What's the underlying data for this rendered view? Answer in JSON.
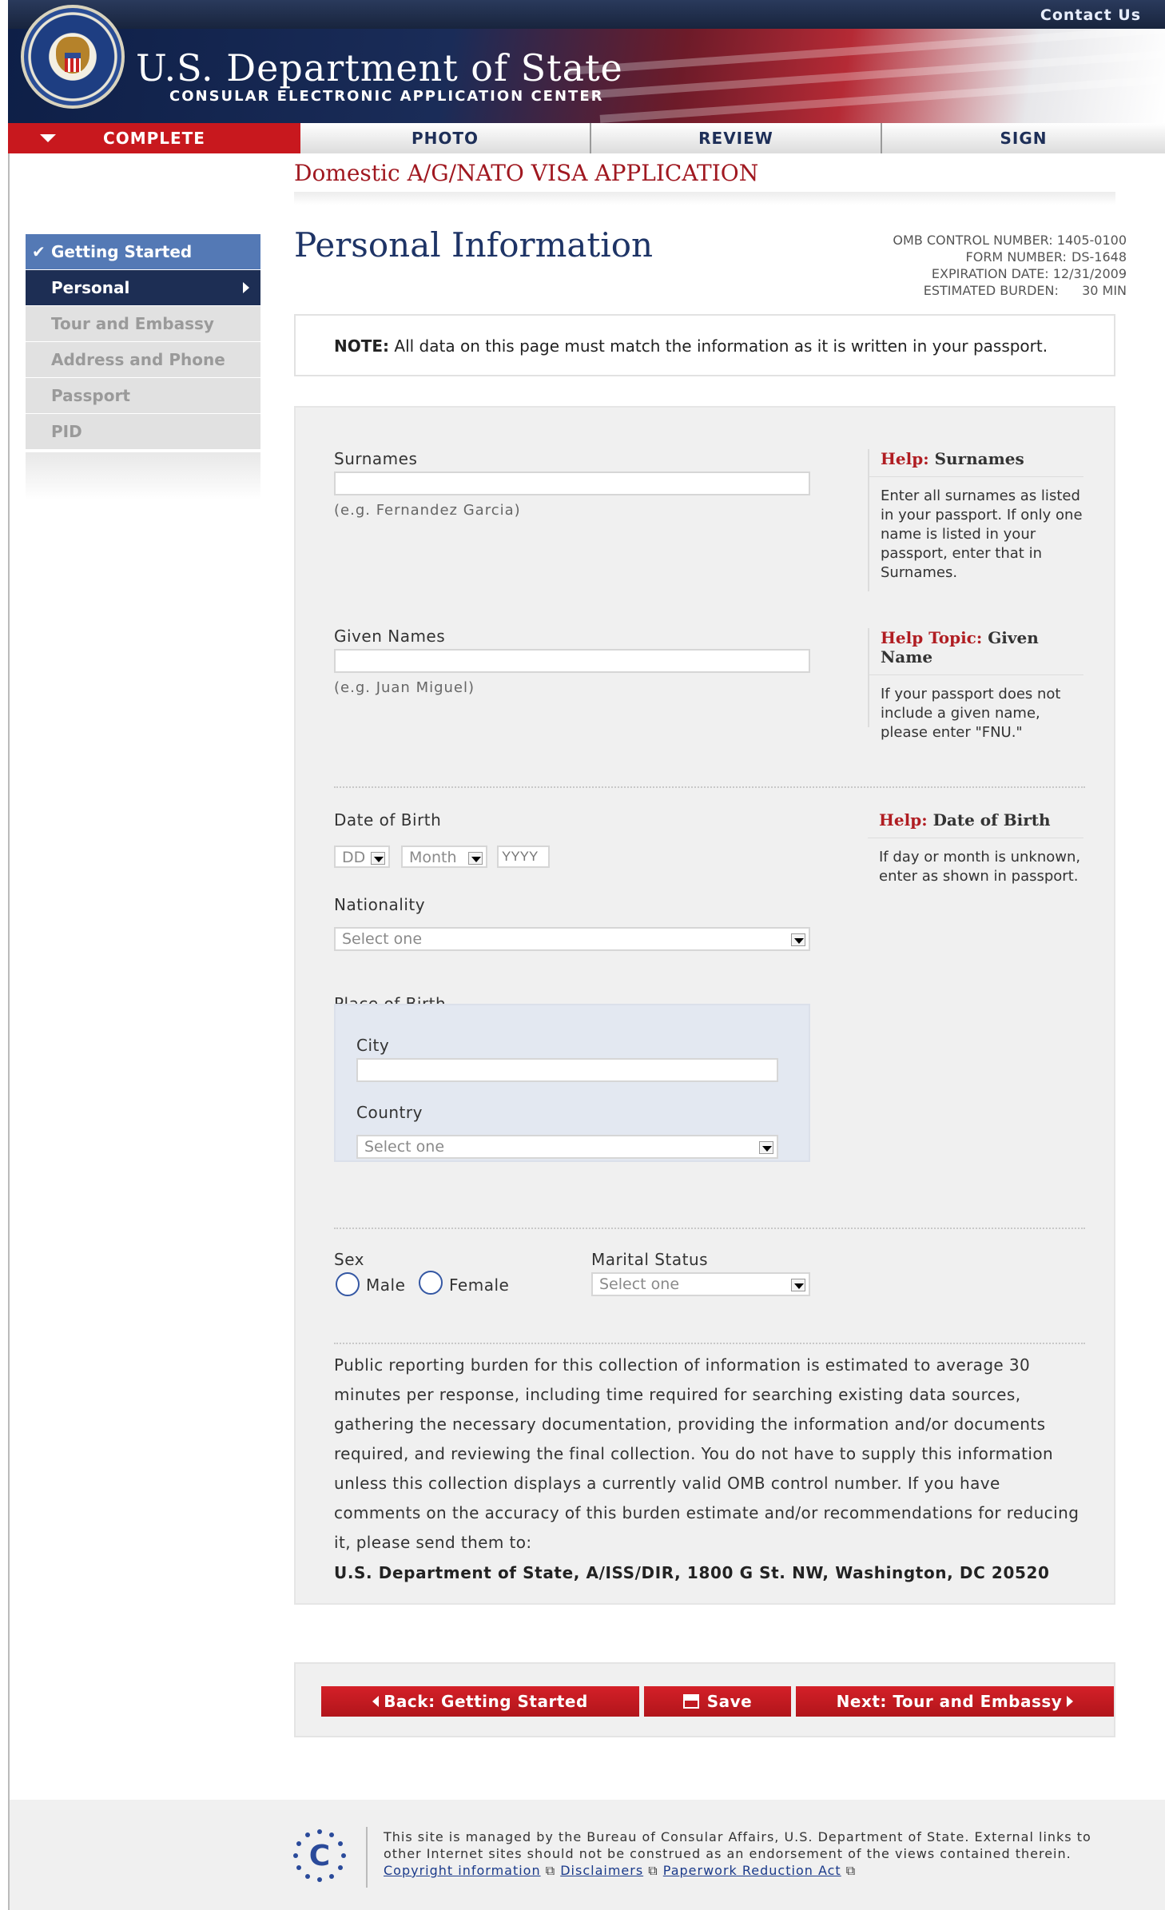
{
  "header": {
    "contact_link": "Contact Us",
    "dept_title": "U.S. Department of State",
    "dept_subtitle": "CONSULAR ELECTRONIC APPLICATION CENTER"
  },
  "nav": {
    "tabs": [
      {
        "label": "COMPLETE"
      },
      {
        "label": "PHOTO"
      },
      {
        "label": "REVIEW"
      },
      {
        "label": "SIGN"
      }
    ]
  },
  "sidebar": {
    "items": [
      {
        "label": "Getting Started",
        "state": "done"
      },
      {
        "label": "Personal",
        "state": "active"
      },
      {
        "label": "Tour and Embassy",
        "state": "disabled"
      },
      {
        "label": "Address and Phone",
        "state": "disabled"
      },
      {
        "label": "Passport",
        "state": "disabled"
      },
      {
        "label": "PID",
        "state": "disabled"
      }
    ]
  },
  "page": {
    "app_title": "Domestic A/G/NATO VISA APPLICATION",
    "title": "Personal Information",
    "omb": {
      "control_number_label": "OMB CONTROL NUMBER:",
      "control_number": "1405-0100",
      "form_number_label": "FORM NUMBER:",
      "form_number": "DS-1648",
      "expiration_label": "EXPIRATION DATE:",
      "expiration": "12/31/2009",
      "burden_label": "ESTIMATED BURDEN:",
      "burden": "30 MIN"
    },
    "note_label": "NOTE:",
    "note_text": " All data on this page must match the information as it is written in your passport."
  },
  "form": {
    "surnames": {
      "label": "Surnames",
      "value": "",
      "hint": "(e.g. Fernandez Garcia)"
    },
    "given_names": {
      "label": "Given Names",
      "value": "",
      "hint": "(e.g. Juan Miguel)"
    },
    "dob": {
      "label": "Date of Birth",
      "day": "DD",
      "month": "Month",
      "year_placeholder": "YYYY"
    },
    "nationality": {
      "label": "Nationality",
      "value": "Select one"
    },
    "place_of_birth": {
      "label": "Place of Birth",
      "city_label": "City",
      "city_value": "",
      "country_label": "Country",
      "country_value": "Select one"
    },
    "sex": {
      "label": "Sex",
      "male": "Male",
      "female": "Female"
    },
    "marital_status": {
      "label": "Marital Status",
      "value": "Select one"
    }
  },
  "help": {
    "surnames": {
      "prefix": "Help:",
      "title": "Surnames",
      "body": "Enter all surnames as listed in your passport. If only one name is listed in your passport, enter that in Surnames."
    },
    "given": {
      "prefix": "Help Topic:",
      "title": "Given Name",
      "body": "If your passport does not include a given name, please enter \"FNU.\""
    },
    "dob": {
      "prefix": "Help:",
      "title": "Date of Birth",
      "body": "If day or month is unknown, enter as shown in passport."
    }
  },
  "burden_statement": {
    "text": "Public reporting burden for this collection of information is estimated to average 30 minutes per response, including time required for searching existing data sources, gathering the necessary documentation, providing the information and/or documents required, and reviewing the final collection.  You do not have to supply this information unless this collection displays a currently valid OMB control number.  If you have comments on the accuracy of this burden estimate and/or recommendations for reducing it, please send them to:",
    "address": "U.S. Department of State, A/ISS/DIR, 1800 G St. NW, Washington, DC 20520"
  },
  "buttons": {
    "back": "Back:  Getting Started",
    "save": "Save",
    "next": "Next: Tour and Embassy"
  },
  "footer": {
    "text": "This site is managed by the Bureau of Consular Affairs, U.S. Department of State. External links to other Internet sites should not be construed as an endorsement of the views contained therein.",
    "copyright_link": "Copyright information",
    "disclaimers_link": "Disclaimers",
    "paperwork_link": "Paperwork Reduction Act",
    "logo_letter": "C"
  },
  "colors": {
    "brand_red": "#c8181e",
    "navy": "#1d2e54",
    "sidebar_done": "#5479b5",
    "link": "#1a3a8a"
  }
}
